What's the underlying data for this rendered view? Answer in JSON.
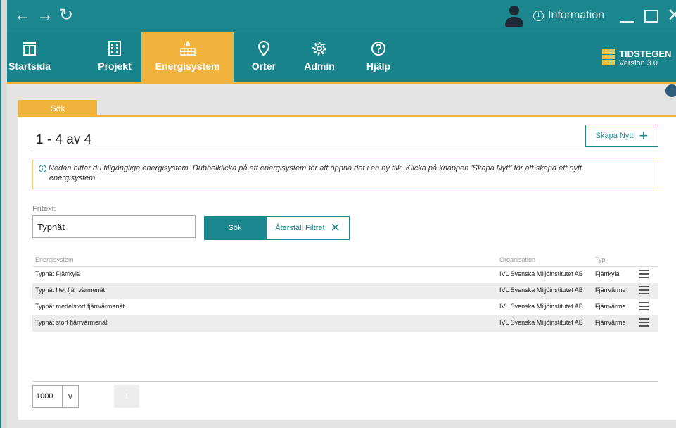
{
  "titlebar": {
    "back_icon": "arrow-left-icon",
    "forward_icon": "arrow-right-icon",
    "refresh_icon": "refresh-icon",
    "info_label": "Information"
  },
  "nav": {
    "items": [
      {
        "label": "Startsida",
        "icon": "home-layout-icon"
      },
      {
        "label": "Projekt",
        "icon": "building-icon"
      },
      {
        "label": "Energisystem",
        "icon": "solar-panel-icon"
      },
      {
        "label": "Orter",
        "icon": "location-pin-icon"
      },
      {
        "label": "Admin",
        "icon": "gear-icon"
      },
      {
        "label": "Hjälp",
        "icon": "question-icon"
      }
    ],
    "active": "Energisystem",
    "brand_name": "TIDSTEGEN",
    "brand_version": "Version 3.0"
  },
  "tabs": [
    {
      "label": "Sök"
    }
  ],
  "panel": {
    "count_text": "1 - 4 av 4",
    "create_label": "Skapa Nytt",
    "info_line1": "Nedan hittar du tillgängliga energisystem. Dubbelklicka på ett energisystem för att öppna det i en ny flik. Klicka på knappen 'Skapa Nytt' för att skapa ett nytt",
    "info_line2": "energisystem.",
    "fritext_label": "Fritext:",
    "fritext_value": "Typnät",
    "search_label": "Sök",
    "reset_label": "Återställ Filtret"
  },
  "table": {
    "headers": {
      "name": "Energisystem",
      "org": "Organisation",
      "typ": "Typ"
    },
    "rows": [
      {
        "name": "Typnät Fjärrkyla",
        "org": "IVL Svenska Miljöinstitutet AB",
        "typ": "Fjärrkyla"
      },
      {
        "name": "Typnät litet fjärrvärmenät",
        "org": "IVL Svenska Miljöinstitutet AB",
        "typ": "Fjärrvärme"
      },
      {
        "name": "Typnät medelstort fjärrvärmenät",
        "org": "IVL Svenska Miljöinstitutet AB",
        "typ": "Fjärrvärme"
      },
      {
        "name": "Typnät stort fjärrvärmenät",
        "org": "IVL Svenska Miljöinstitutet AB",
        "typ": "Fjärrvärme"
      }
    ]
  },
  "pagination": {
    "page_size": "1000",
    "current_page": "1"
  },
  "colors": {
    "teal": "#1b868d",
    "accent": "#f0b43c"
  }
}
